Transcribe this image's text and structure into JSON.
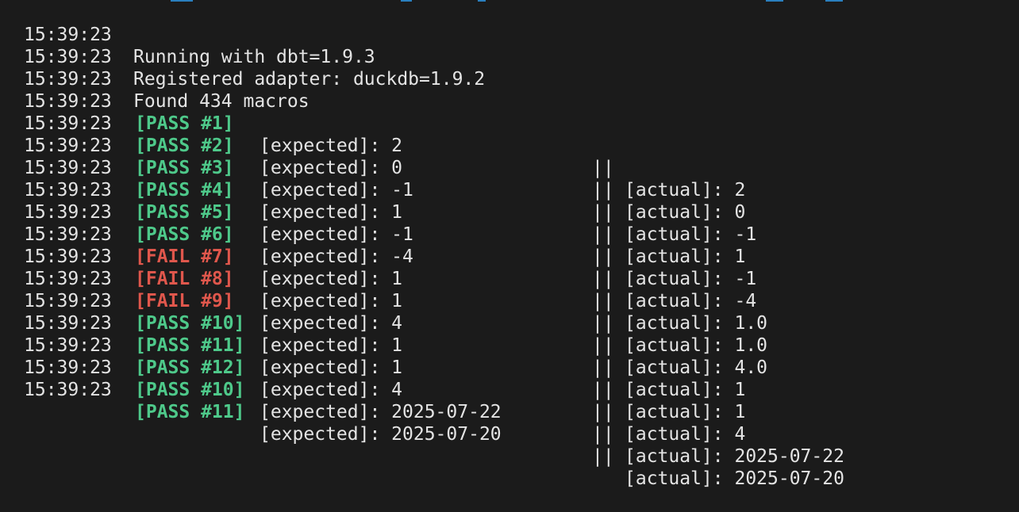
{
  "colors": {
    "background": "#1b1b1b",
    "text": "#e4e4e4",
    "pass": "#4ec98a",
    "fail": "#e0574c"
  },
  "info_lines": [
    {
      "time": "15:39:23",
      "message": "Running with dbt=1.9.3"
    },
    {
      "time": "15:39:23",
      "message": "Registered adapter: duckdb=1.9.2"
    },
    {
      "time": "15:39:23",
      "message": "Found 434 macros"
    }
  ],
  "separator": "||",
  "test_lines": [
    {
      "time": "15:39:23",
      "status": "pass",
      "tag": "[PASS #1]",
      "expected": "[expected]: 2",
      "actual": "[actual]: 2"
    },
    {
      "time": "15:39:23",
      "status": "pass",
      "tag": "[PASS #2]",
      "expected": "[expected]: 0",
      "actual": "[actual]: 0"
    },
    {
      "time": "15:39:23",
      "status": "pass",
      "tag": "[PASS #3]",
      "expected": "[expected]: -1",
      "actual": "[actual]: -1"
    },
    {
      "time": "15:39:23",
      "status": "pass",
      "tag": "[PASS #4]",
      "expected": "[expected]: 1",
      "actual": "[actual]: 1"
    },
    {
      "time": "15:39:23",
      "status": "pass",
      "tag": "[PASS #5]",
      "expected": "[expected]: -1",
      "actual": "[actual]: -1"
    },
    {
      "time": "15:39:23",
      "status": "pass",
      "tag": "[PASS #6]",
      "expected": "[expected]: -4",
      "actual": "[actual]: -4"
    },
    {
      "time": "15:39:23",
      "status": "fail",
      "tag": "[FAIL #7]",
      "expected": "[expected]: 1",
      "actual": "[actual]: 1.0"
    },
    {
      "time": "15:39:23",
      "status": "fail",
      "tag": "[FAIL #8]",
      "expected": "[expected]: 1",
      "actual": "[actual]: 1.0"
    },
    {
      "time": "15:39:23",
      "status": "fail",
      "tag": "[FAIL #9]",
      "expected": "[expected]: 4",
      "actual": "[actual]: 4.0"
    },
    {
      "time": "15:39:23",
      "status": "pass",
      "tag": "[PASS #10]",
      "expected": "[expected]: 1",
      "actual": "[actual]: 1"
    },
    {
      "time": "15:39:23",
      "status": "pass",
      "tag": "[PASS #11]",
      "expected": "[expected]: 1",
      "actual": "[actual]: 1"
    },
    {
      "time": "15:39:23",
      "status": "pass",
      "tag": "[PASS #12]",
      "expected": "[expected]: 4",
      "actual": "[actual]: 4"
    },
    {
      "time": "15:39:23",
      "status": "pass",
      "tag": "[PASS #10]",
      "expected": "[expected]: 2025-07-22",
      "actual": "[actual]: 2025-07-22"
    },
    {
      "time": "15:39:23",
      "status": "pass",
      "tag": "[PASS #11]",
      "expected": "[expected]: 2025-07-20",
      "actual": "[actual]: 2025-07-20"
    }
  ]
}
